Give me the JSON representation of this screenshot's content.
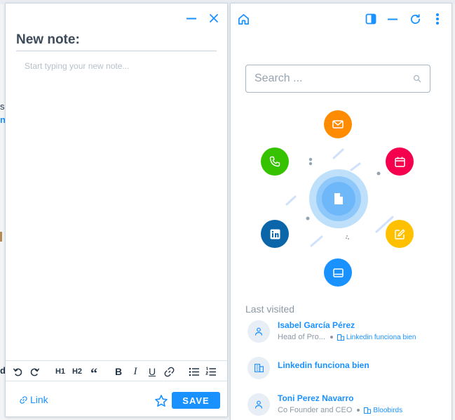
{
  "background": {
    "frag_s": "s",
    "frag_m": "n",
    "frag_d": "d"
  },
  "note": {
    "title": "New note:",
    "placeholder": "Start typing your new note...",
    "toolbar": {
      "h1": "H1",
      "h2": "H2",
      "quote": "“",
      "bold": "B",
      "italic": "I",
      "underline": "U"
    },
    "link_label": "Link",
    "save_label": "SAVE"
  },
  "bubble": {
    "search_placeholder": "Search ...",
    "actions": [
      "email-icon",
      "phone-icon",
      "calendar-icon",
      "linkedin-icon",
      "note-edit-icon",
      "browser-icon"
    ],
    "colors": {
      "email": "#ff8c00",
      "phone": "#37c200",
      "calendar": "#f5004e",
      "linkedin": "#0a66a8",
      "note": "#ffc000",
      "browser": "#1991ff",
      "accent": "#1991ff"
    },
    "last_visited_title": "Last visited",
    "last_visited": [
      {
        "name": "Isabel García Pérez",
        "subtitle": "Head of Pro...",
        "company": "Linkedin funciona bien"
      },
      {
        "name": "Linkedin funciona bien"
      },
      {
        "name": "Toni Perez Navarro",
        "subtitle": "Co Founder and CEO",
        "company": "Bloobirds"
      }
    ]
  }
}
